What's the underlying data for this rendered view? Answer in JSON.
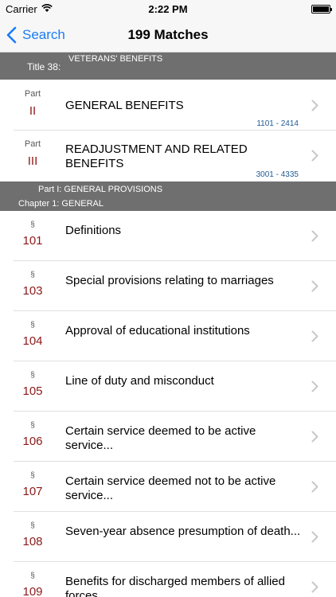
{
  "status_bar": {
    "carrier": "Carrier",
    "time": "2:22 PM",
    "battery_level": 1.0
  },
  "nav": {
    "back_label": "Search",
    "title": "199 Matches"
  },
  "title_header": {
    "prefix": "Title 38:",
    "name": "VETERANS' BENEFITS"
  },
  "parts": [
    {
      "label": "Part",
      "number": "II",
      "title": "GENERAL BENEFITS",
      "range": "1101 - 2414"
    },
    {
      "label": "Part",
      "number": "III",
      "title": "READJUSTMENT AND RELATED BENEFITS",
      "range": "3001 - 4335"
    }
  ],
  "section_header": {
    "part": "Part I: GENERAL PROVISIONS",
    "chapter": "Chapter 1: GENERAL"
  },
  "sections": [
    {
      "symbol": "§",
      "number": "101",
      "title": "Definitions"
    },
    {
      "symbol": "§",
      "number": "103",
      "title": "Special provisions relating to marriages"
    },
    {
      "symbol": "§",
      "number": "104",
      "title": "Approval of educational institutions"
    },
    {
      "symbol": "§",
      "number": "105",
      "title": "Line of duty and misconduct"
    },
    {
      "symbol": "§",
      "number": "106",
      "title": "Certain service deemed to be active service..."
    },
    {
      "symbol": "§",
      "number": "107",
      "title": "Certain service deemed not to be active service..."
    },
    {
      "symbol": "§",
      "number": "108",
      "title": "Seven-year absence presumption of death..."
    },
    {
      "symbol": "§",
      "number": "109",
      "title": "Benefits for discharged members of allied forces..."
    }
  ],
  "icons": {
    "back": "chevron-left-icon",
    "disclosure": "chevron-right-icon",
    "wifi": "wifi-icon",
    "battery": "battery-icon"
  },
  "colors": {
    "accent": "#1a7cf5",
    "section_number": "#8b1a1a",
    "range_text": "#1f5a94",
    "header_bg": "#6f6f6f"
  }
}
